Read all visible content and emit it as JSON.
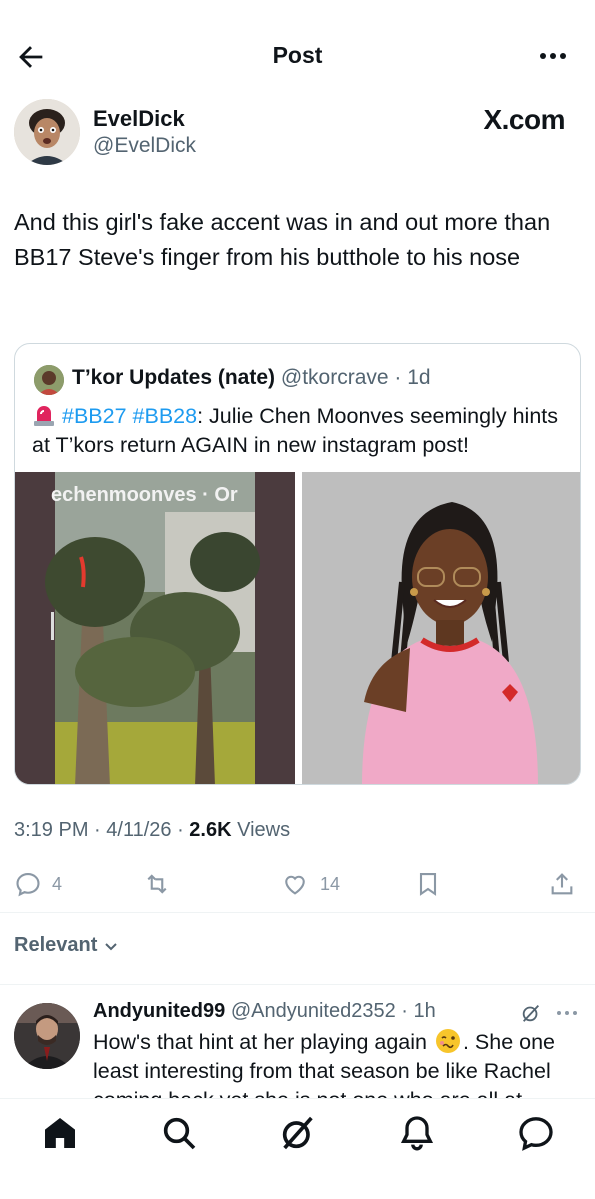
{
  "header": {
    "title": "Post",
    "back_icon": "arrow-left-icon",
    "more_icon": "more-horizontal-icon"
  },
  "author": {
    "name": "EvelDick",
    "handle": "@EvelDick",
    "source_label": "X.com"
  },
  "post": {
    "text": "And this girl's fake accent was in and out more than BB17 Steve's finger from his butthole to his nose",
    "time": "3:19 PM",
    "date": "4/11/26",
    "views_count": "2.6K",
    "views_label": "Views",
    "separator": " · "
  },
  "quote": {
    "name": "T’kor Updates (nate)",
    "handle": "@tkorcrave",
    "age": "1d",
    "hashtag1": "#BB27",
    "hashtag2": "#BB28",
    "text_rest": ": Julie Chen Moonves seemingly hints at T’kors return AGAIN in new instagram post!",
    "image_left_overlay": "echenmoonves · Or"
  },
  "actions": {
    "replies": "4",
    "reposts": "",
    "likes": "14"
  },
  "filter": {
    "label": "Relevant"
  },
  "reply": {
    "name": "Andyunited99",
    "handle": "@Andyunited2352",
    "age": "1h",
    "text_before_emoji": "How's that hint at her playing again ",
    "text_after_emoji": ". She one least interesting from that season be like Rachel coming back yet she is not one who are all at"
  },
  "tabs": [
    "home-icon",
    "search-icon",
    "grok-icon",
    "notifications-icon",
    "messages-icon"
  ],
  "colors": {
    "accent": "#1d9bf0",
    "text": "#0f1419",
    "muted": "#536471",
    "siren": "#e0245e"
  }
}
